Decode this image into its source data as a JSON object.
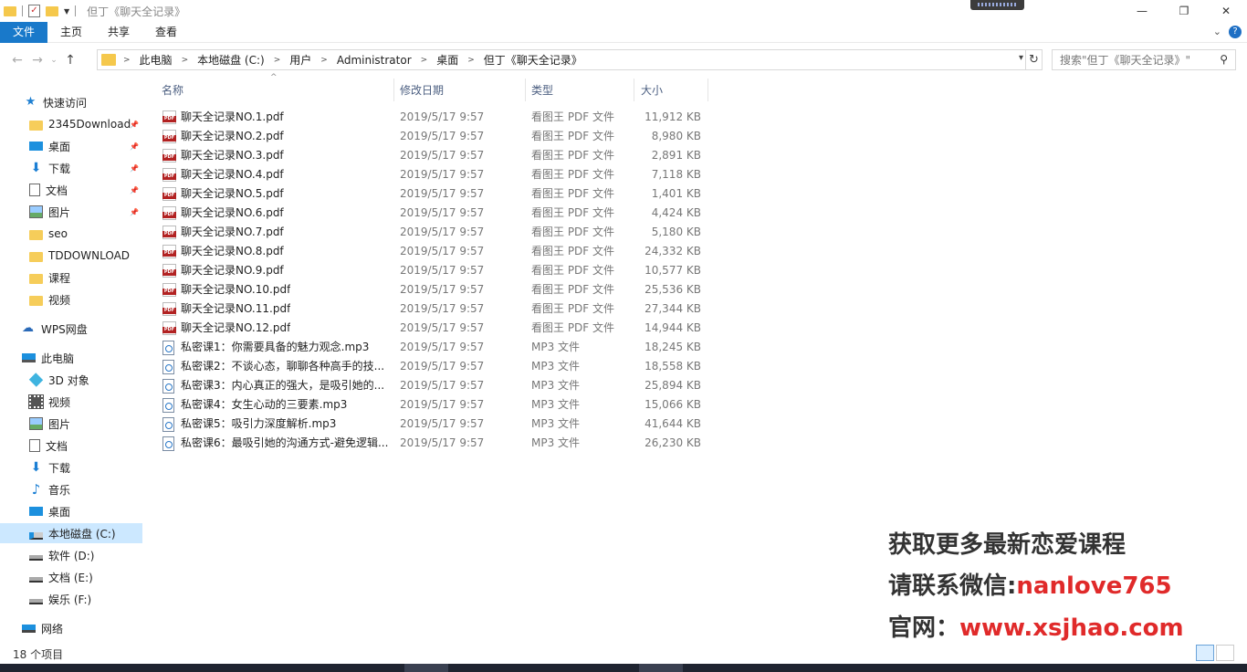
{
  "window": {
    "title": "但丁《聊天全记录》"
  },
  "ribbon": {
    "tabs": [
      "文件",
      "主页",
      "共享",
      "查看"
    ]
  },
  "address": {
    "crumbs": [
      "此电脑",
      "本地磁盘 (C:)",
      "用户",
      "Administrator",
      "桌面",
      "但丁《聊天全记录》"
    ],
    "search_placeholder": "搜索\"但丁《聊天全记录》\""
  },
  "sidebar": {
    "quick_access": "快速访问",
    "quick_items": [
      {
        "label": "2345Download",
        "icon": "folder-icon",
        "pinned": true
      },
      {
        "label": "桌面",
        "icon": "desktop-icon",
        "pinned": true
      },
      {
        "label": "下载",
        "icon": "download-icon",
        "pinned": true
      },
      {
        "label": "文档",
        "icon": "document-icon",
        "pinned": true
      },
      {
        "label": "图片",
        "icon": "picture-icon",
        "pinned": true
      },
      {
        "label": "seo",
        "icon": "folder-icon",
        "pinned": false
      },
      {
        "label": "TDDOWNLOAD",
        "icon": "folder-icon",
        "pinned": false
      },
      {
        "label": "课程",
        "icon": "folder-icon",
        "pinned": false
      },
      {
        "label": "视频",
        "icon": "folder-icon",
        "pinned": false
      }
    ],
    "wps": "WPS网盘",
    "this_pc": "此电脑",
    "pc_items": [
      {
        "label": "3D 对象",
        "icon": "3d-objects-icon"
      },
      {
        "label": "视频",
        "icon": "video-icon"
      },
      {
        "label": "图片",
        "icon": "picture-icon"
      },
      {
        "label": "文档",
        "icon": "document-icon"
      },
      {
        "label": "下载",
        "icon": "download-icon"
      },
      {
        "label": "音乐",
        "icon": "music-icon"
      },
      {
        "label": "桌面",
        "icon": "desktop-icon"
      },
      {
        "label": "本地磁盘 (C:)",
        "icon": "system-drive-icon",
        "selected": true
      },
      {
        "label": "软件 (D:)",
        "icon": "drive-icon"
      },
      {
        "label": "文档 (E:)",
        "icon": "drive-icon"
      },
      {
        "label": "娱乐 (F:)",
        "icon": "drive-icon"
      }
    ],
    "network": "网络"
  },
  "columns": {
    "name": "名称",
    "date": "修改日期",
    "type": "类型",
    "size": "大小"
  },
  "files": [
    {
      "name": "聊天全记录NO.1.pdf",
      "date": "2019/5/17 9:57",
      "type": "看图王 PDF 文件",
      "size": "11,912 KB",
      "kind": "pdf"
    },
    {
      "name": "聊天全记录NO.2.pdf",
      "date": "2019/5/17 9:57",
      "type": "看图王 PDF 文件",
      "size": "8,980 KB",
      "kind": "pdf"
    },
    {
      "name": "聊天全记录NO.3.pdf",
      "date": "2019/5/17 9:57",
      "type": "看图王 PDF 文件",
      "size": "2,891 KB",
      "kind": "pdf"
    },
    {
      "name": "聊天全记录NO.4.pdf",
      "date": "2019/5/17 9:57",
      "type": "看图王 PDF 文件",
      "size": "7,118 KB",
      "kind": "pdf"
    },
    {
      "name": "聊天全记录NO.5.pdf",
      "date": "2019/5/17 9:57",
      "type": "看图王 PDF 文件",
      "size": "1,401 KB",
      "kind": "pdf"
    },
    {
      "name": "聊天全记录NO.6.pdf",
      "date": "2019/5/17 9:57",
      "type": "看图王 PDF 文件",
      "size": "4,424 KB",
      "kind": "pdf"
    },
    {
      "name": "聊天全记录NO.7.pdf",
      "date": "2019/5/17 9:57",
      "type": "看图王 PDF 文件",
      "size": "5,180 KB",
      "kind": "pdf"
    },
    {
      "name": "聊天全记录NO.8.pdf",
      "date": "2019/5/17 9:57",
      "type": "看图王 PDF 文件",
      "size": "24,332 KB",
      "kind": "pdf"
    },
    {
      "name": "聊天全记录NO.9.pdf",
      "date": "2019/5/17 9:57",
      "type": "看图王 PDF 文件",
      "size": "10,577 KB",
      "kind": "pdf"
    },
    {
      "name": "聊天全记录NO.10.pdf",
      "date": "2019/5/17 9:57",
      "type": "看图王 PDF 文件",
      "size": "25,536 KB",
      "kind": "pdf"
    },
    {
      "name": "聊天全记录NO.11.pdf",
      "date": "2019/5/17 9:57",
      "type": "看图王 PDF 文件",
      "size": "27,344 KB",
      "kind": "pdf"
    },
    {
      "name": "聊天全记录NO.12.pdf",
      "date": "2019/5/17 9:57",
      "type": "看图王 PDF 文件",
      "size": "14,944 KB",
      "kind": "pdf"
    },
    {
      "name": "私密课1：你需要具备的魅力观念.mp3",
      "date": "2019/5/17 9:57",
      "type": "MP3 文件",
      "size": "18,245 KB",
      "kind": "mp3"
    },
    {
      "name": "私密课2：不谈心态，聊聊各种高手的技...",
      "date": "2019/5/17 9:57",
      "type": "MP3 文件",
      "size": "18,558 KB",
      "kind": "mp3"
    },
    {
      "name": "私密课3：内心真正的强大，是吸引她的...",
      "date": "2019/5/17 9:57",
      "type": "MP3 文件",
      "size": "25,894 KB",
      "kind": "mp3"
    },
    {
      "name": "私密课4：女生心动的三要素.mp3",
      "date": "2019/5/17 9:57",
      "type": "MP3 文件",
      "size": "15,066 KB",
      "kind": "mp3"
    },
    {
      "name": "私密课5：吸引力深度解析.mp3",
      "date": "2019/5/17 9:57",
      "type": "MP3 文件",
      "size": "41,644 KB",
      "kind": "mp3"
    },
    {
      "name": "私密课6：最吸引她的沟通方式-避免逻辑...",
      "date": "2019/5/17 9:57",
      "type": "MP3 文件",
      "size": "26,230 KB",
      "kind": "mp3"
    }
  ],
  "watermark": {
    "line1": "获取更多最新恋爱课程",
    "line2_label": "请联系微信:",
    "line2_value": "nanlove765",
    "line3_label": "官网：",
    "line3_value": "www.xsjhao.com",
    "accent": "#e02a2a"
  },
  "status": {
    "count": "18 个项目"
  },
  "colors": {
    "file_tab": "#1979ca",
    "selected": "#cce8ff",
    "header_text": "#4d6082"
  }
}
